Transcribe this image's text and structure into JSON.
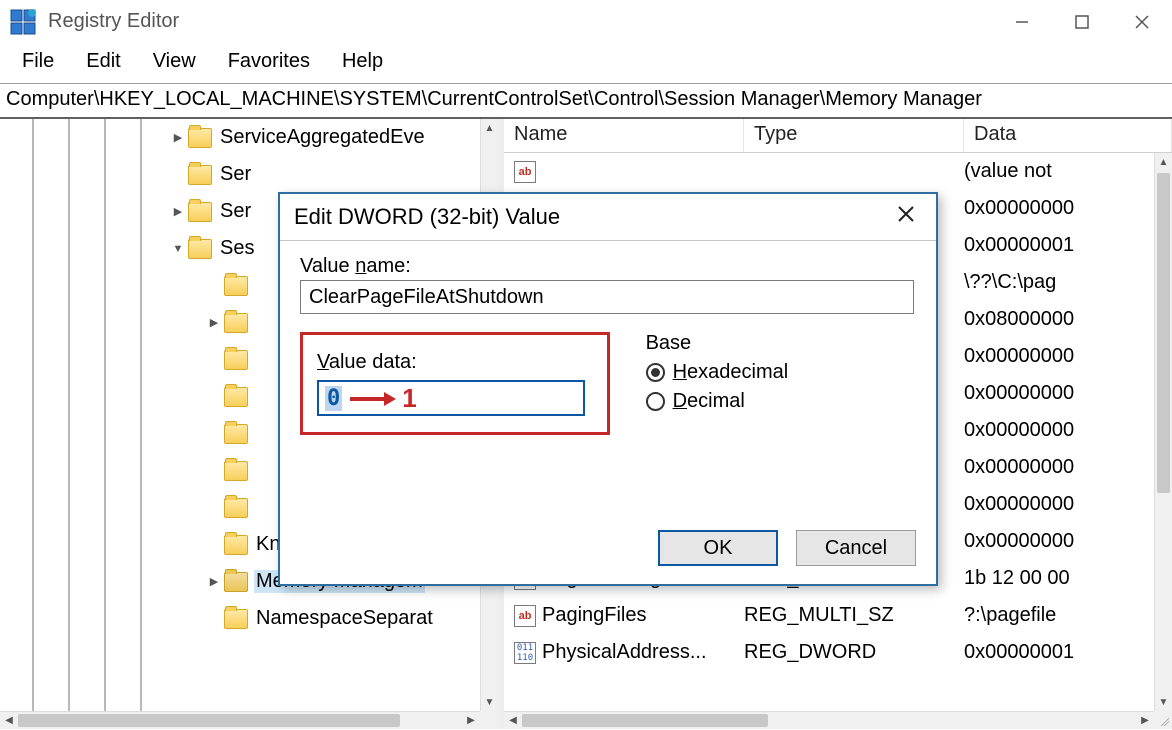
{
  "window": {
    "title": "Registry Editor"
  },
  "menu": {
    "file": "File",
    "edit": "Edit",
    "view": "View",
    "favorites": "Favorites",
    "help": "Help"
  },
  "address": "Computer\\HKEY_LOCAL_MACHINE\\SYSTEM\\CurrentControlSet\\Control\\Session Manager\\Memory Manager",
  "tree": {
    "items": [
      {
        "indent": 168,
        "expander": ">",
        "label": "ServiceAggregatedEve"
      },
      {
        "indent": 168,
        "expander": "",
        "label": "Ser"
      },
      {
        "indent": 168,
        "expander": ">",
        "label": "Ser"
      },
      {
        "indent": 168,
        "expander": "v",
        "label": "Ses"
      },
      {
        "indent": 204,
        "expander": "",
        "label": ""
      },
      {
        "indent": 204,
        "expander": ">",
        "label": ""
      },
      {
        "indent": 204,
        "expander": "",
        "label": ""
      },
      {
        "indent": 204,
        "expander": "",
        "label": ""
      },
      {
        "indent": 204,
        "expander": "",
        "label": ""
      },
      {
        "indent": 204,
        "expander": "",
        "label": ""
      },
      {
        "indent": 204,
        "expander": "",
        "label": ""
      },
      {
        "indent": 204,
        "expander": "",
        "label": "KnownDLLs"
      },
      {
        "indent": 204,
        "expander": ">",
        "label": "Memory Managem",
        "selected": true
      },
      {
        "indent": 204,
        "expander": "",
        "label": "NamespaceSeparat"
      }
    ]
  },
  "list": {
    "headers": {
      "name": "Name",
      "type": "Type",
      "data": "Data"
    },
    "rows": [
      {
        "icon": "str",
        "name": "",
        "type": "",
        "data": "(value not "
      },
      {
        "icon": "bin",
        "name": "",
        "type": "",
        "data": "0x00000000"
      },
      {
        "icon": "bin",
        "name": "",
        "type": "",
        "data": "0x00000001"
      },
      {
        "icon": "str",
        "name": "",
        "type": "",
        "data": "\\??\\C:\\pag"
      },
      {
        "icon": "bin",
        "name": "",
        "type": "",
        "data": "0x08000000"
      },
      {
        "icon": "bin",
        "name": "",
        "type": "",
        "data": "0x00000000"
      },
      {
        "icon": "bin",
        "name": "",
        "type": "",
        "data": "0x00000000"
      },
      {
        "icon": "bin",
        "name": "",
        "type": "",
        "data": "0x00000000"
      },
      {
        "icon": "bin",
        "name": "",
        "type": "",
        "data": "0x00000000"
      },
      {
        "icon": "bin",
        "name": "",
        "type": "",
        "data": "0x00000000"
      },
      {
        "icon": "bin",
        "name": "",
        "type": "",
        "data": "0x00000000"
      },
      {
        "icon": "bin",
        "name": "PagefileUsage",
        "type": "REG_BINARY",
        "data": "1b 12 00 00"
      },
      {
        "icon": "str",
        "name": "PagingFiles",
        "type": "REG_MULTI_SZ",
        "data": "?:\\pagefile"
      },
      {
        "icon": "bin",
        "name": "PhysicalAddress...",
        "type": "REG_DWORD",
        "data": "0x00000001"
      }
    ]
  },
  "dialog": {
    "title": "Edit DWORD (32-bit) Value",
    "value_name_label": "Value name:",
    "value_name": "ClearPageFileAtShutdown",
    "value_data_label": "Value data:",
    "value_data_current": "0",
    "value_data_target": "1",
    "base_label": "Base",
    "hex_label": "Hexadecimal",
    "dec_label": "Decimal",
    "ok": "OK",
    "cancel": "Cancel"
  }
}
